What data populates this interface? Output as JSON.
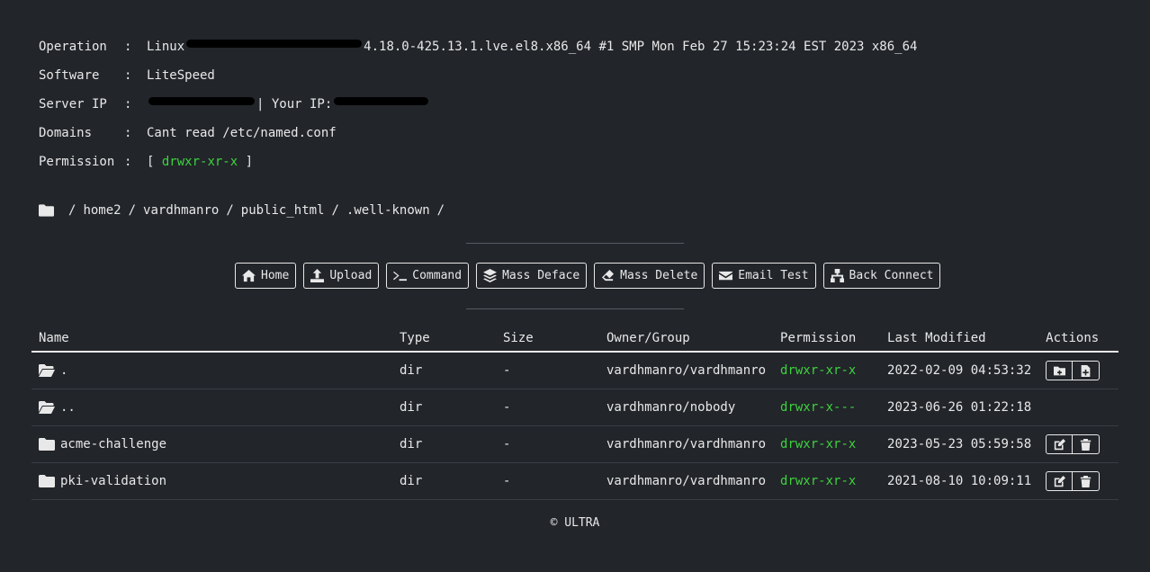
{
  "info": {
    "operation": {
      "key": "Operation",
      "sep": ":",
      "prefix": "Linux",
      "value": "4.18.0-425.13.1.lve.el8.x86_64 #1 SMP Mon Feb 27 15:23:24 EST 2023 x86_64"
    },
    "software": {
      "key": "Software",
      "sep": ":",
      "value": "LiteSpeed"
    },
    "server_ip": {
      "key": "Server IP",
      "sep": ":",
      "separator": "| Your IP:"
    },
    "domains": {
      "key": "Domains",
      "sep": ":",
      "value": "Cant read /etc/named.conf"
    },
    "permission": {
      "key": "Permission",
      "sep": ":",
      "open": "[",
      "value": "drwxr-xr-x",
      "close": "]"
    }
  },
  "breadcrumb": [
    "/",
    "home2",
    "/",
    "vardhmanro",
    "/",
    "public_html",
    "/",
    ".well-known",
    "/"
  ],
  "toolbar": {
    "home": "Home",
    "upload": "Upload",
    "command": "Command",
    "mass_deface": "Mass Deface",
    "mass_delete": "Mass Delete",
    "email_test": "Email Test",
    "back_connect": "Back Connect"
  },
  "table": {
    "headers": [
      "Name",
      "Type",
      "Size",
      "Owner/Group",
      "Permission",
      "Last Modified",
      "Actions"
    ],
    "rows": [
      {
        "name": ".",
        "type": "dir",
        "size": "-",
        "owner": "vardhmanro/vardhmanro",
        "perm": "drwxr-xr-x",
        "modified": "2022-02-09 04:53:32"
      },
      {
        "name": "..",
        "type": "dir",
        "size": "-",
        "owner": "vardhmanro/nobody",
        "perm": "drwxr-x---",
        "modified": "2023-06-26 01:22:18"
      },
      {
        "name": "acme-challenge",
        "type": "dir",
        "size": "-",
        "owner": "vardhmanro/vardhmanro",
        "perm": "drwxr-xr-x",
        "modified": "2023-05-23 05:59:58"
      },
      {
        "name": "pki-validation",
        "type": "dir",
        "size": "-",
        "owner": "vardhmanro/vardhmanro",
        "perm": "drwxr-xr-x",
        "modified": "2021-08-10 10:09:11"
      }
    ]
  },
  "footer": "© ULTRA",
  "colors": {
    "background": "#22252a",
    "text": "#e8e8e8",
    "permission_green": "#3ed23e"
  }
}
